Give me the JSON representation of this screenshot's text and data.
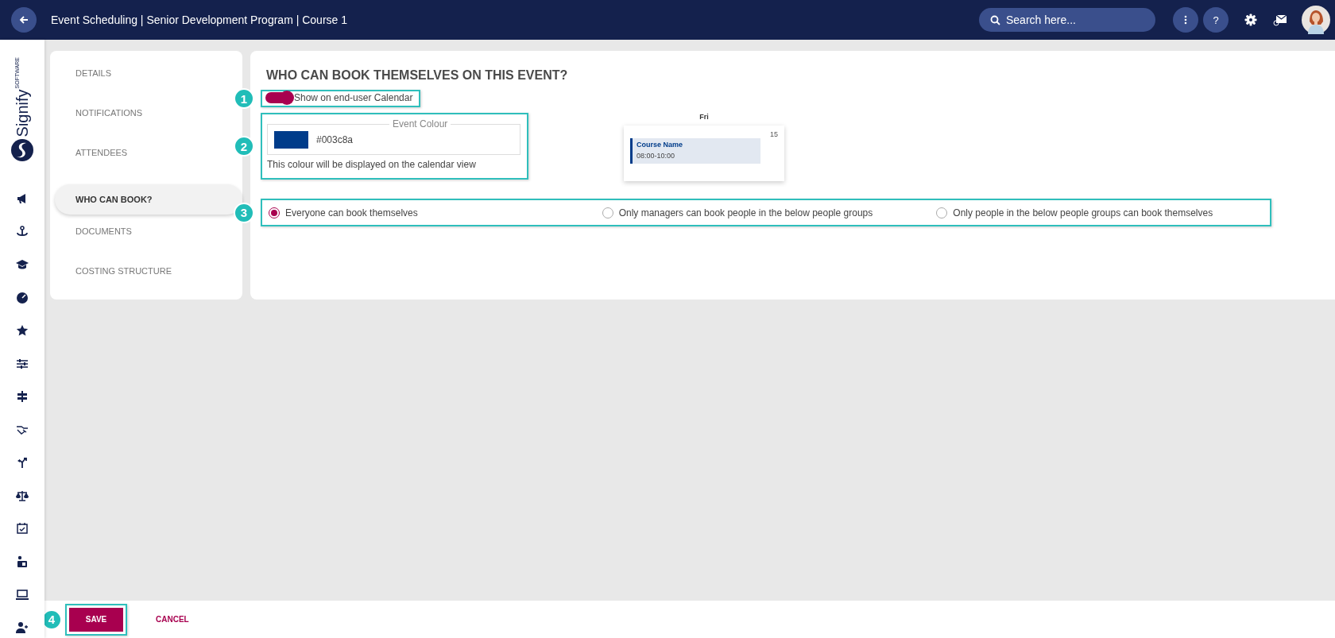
{
  "header": {
    "title": "Event Scheduling | Senior Development Program | Course 1",
    "search": {
      "placeholder": "Search here..."
    },
    "help": "?"
  },
  "brand": {
    "name": "Signify",
    "tagline": "SOFTWARE"
  },
  "tabs": [
    {
      "label": "DETAILS",
      "selected": false
    },
    {
      "label": "NOTIFICATIONS",
      "selected": false
    },
    {
      "label": "ATTENDEES",
      "selected": false
    },
    {
      "label": "WHO CAN BOOK?",
      "selected": true
    },
    {
      "label": "DOCUMENTS",
      "selected": false
    },
    {
      "label": "COSTING STRUCTURE",
      "selected": false
    }
  ],
  "section": {
    "title": "WHO CAN BOOK THEMSELVES ON THIS EVENT?",
    "calendar_toggle": {
      "label": "Show on end-user Calendar",
      "on": true
    },
    "event_colour": {
      "legend": "Event Colour",
      "value": "#003c8a",
      "color": "#003c8a",
      "hint": "This colour will be displayed on the calendar view"
    },
    "preview": {
      "day": "Fri",
      "date": "15",
      "event_title": "Course Name",
      "event_time": "08:00-10:00"
    },
    "options": [
      {
        "label": "Everyone can book themselves",
        "selected": true
      },
      {
        "label": "Only managers can book people in the below people groups",
        "selected": false
      },
      {
        "label": "Only people in the below people groups can book themselves",
        "selected": false
      }
    ]
  },
  "callouts": [
    "1",
    "2",
    "3",
    "4"
  ],
  "buttons": {
    "save": "SAVE",
    "cancel": "CANCEL"
  }
}
